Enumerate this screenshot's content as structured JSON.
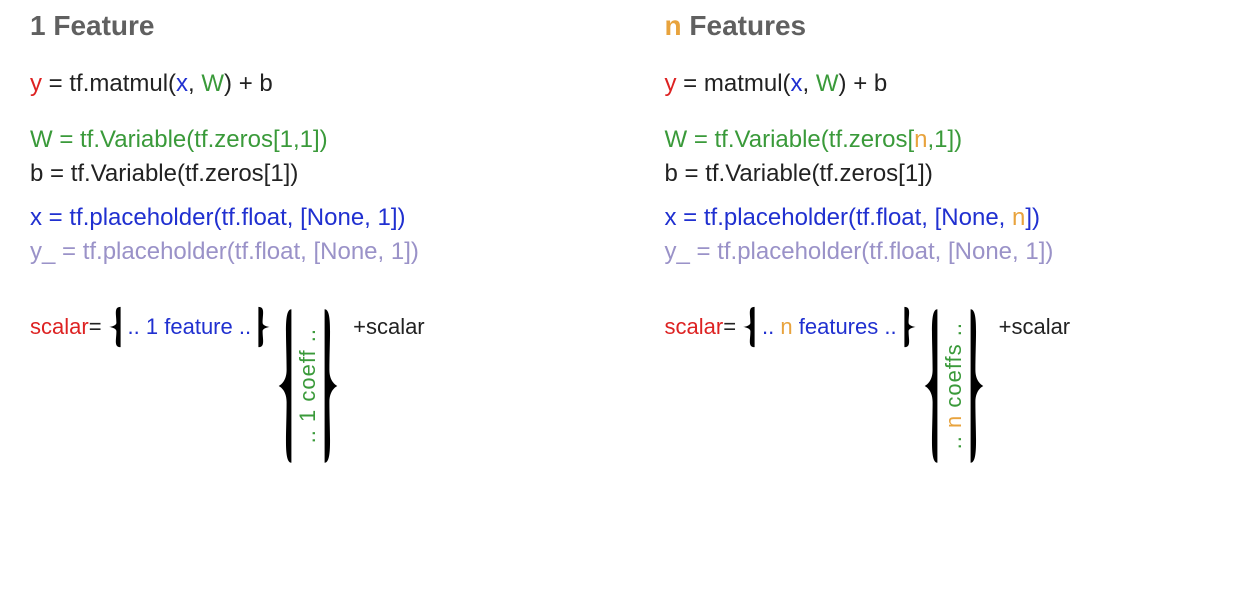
{
  "left": {
    "heading_prefix": "1",
    "heading_suffix": " Feature",
    "eq": {
      "y": "y",
      "eq": " = ",
      "fn": "tf.matmul(",
      "x": "x",
      "sep": ", ",
      "W": "W",
      "close": ") + ",
      "b": "b"
    },
    "W_line": "W = tf.Variable(tf.zeros[1,1])",
    "b_line": "b = tf.Variable(tf.zeros[1])",
    "x_line": "x = tf.placeholder(tf.float, [None, 1])",
    "y_line": "y_ = tf.placeholder(tf.float, [None, 1])",
    "schematic": {
      "lhs": "scalar",
      "eq": " = ",
      "row_prefix": ".. ",
      "row_accent": "1",
      "row_suffix": " feature ..",
      "col_prefix": ".. ",
      "col_accent": "1",
      "col_suffix": " coeff ..",
      "plus": " + ",
      "rhs": "scalar"
    }
  },
  "right": {
    "heading_prefix": "n",
    "heading_suffix": " Features",
    "eq": {
      "y": "y",
      "eq": " = ",
      "fn": "matmul(",
      "x": "x",
      "sep": ", ",
      "W": "W",
      "close": ") + ",
      "b": "b"
    },
    "W_pre": "W = tf.Variable(tf.zeros[",
    "W_accent": "n",
    "W_post": ",1])",
    "b_line": "b = tf.Variable(tf.zeros[1])",
    "x_pre": "x = tf.placeholder(tf.float, [None, ",
    "x_accent": "n",
    "x_post": "])",
    "y_line": "y_ = tf.placeholder(tf.float, [None, 1])",
    "schematic": {
      "lhs": "scalar",
      "eq": " = ",
      "row_prefix": ".. ",
      "row_accent": "n",
      "row_suffix": " features ..",
      "col_prefix": ".. ",
      "col_accent": "n",
      "col_suffix": " coeffs ..",
      "plus": " + ",
      "rhs": "scalar"
    }
  }
}
